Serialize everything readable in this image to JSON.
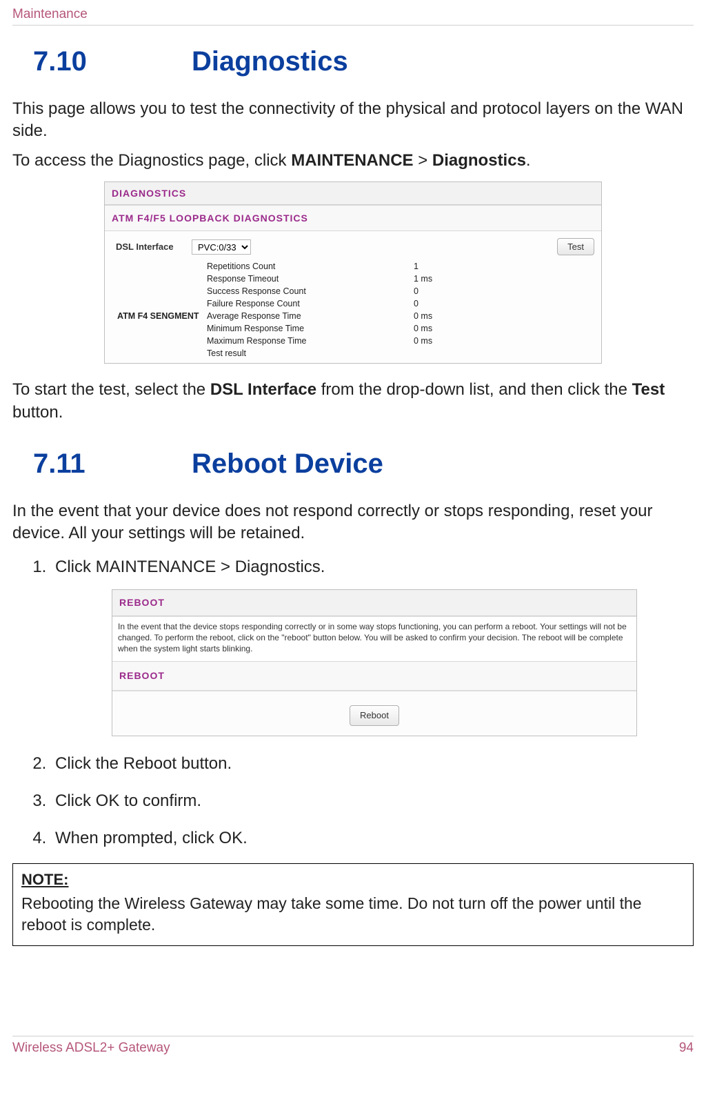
{
  "header": "Maintenance",
  "section1": {
    "num": "7.10",
    "title": "Diagnostics"
  },
  "para_intro": "This page allows you to test the connectivity of the physical and protocol layers on the WAN side.",
  "para_access_pre": "To access the Diagnostics page, click ",
  "para_access_b1": "MAINTENANCE",
  "para_access_mid": " > ",
  "para_access_b2": "Diagnostics",
  "para_access_post": ".",
  "diag": {
    "panel_title": "DIAGNOSTICS",
    "sub_title": "ATM F4/F5 LOOPBACK DIAGNOSTICS",
    "dsl_label": "DSL Interface",
    "dsl_value": "PVC:0/33",
    "test_btn": "Test",
    "group_label": "ATM F4 SENGMENT",
    "rows": [
      {
        "k": "Repetitions Count",
        "v": "1"
      },
      {
        "k": "Response Timeout",
        "v": "1 ms"
      },
      {
        "k": "Success Response Count",
        "v": "0"
      },
      {
        "k": "Failure Response Count",
        "v": "0"
      },
      {
        "k": "Average Response Time",
        "v": "0 ms"
      },
      {
        "k": "Minimum Response Time",
        "v": "0 ms"
      },
      {
        "k": "Maximum Response Time",
        "v": "0 ms"
      },
      {
        "k": "Test result",
        "v": ""
      }
    ]
  },
  "para_start_pre": "To start the test, select the ",
  "para_start_b1": "DSL Interface",
  "para_start_mid": " from the drop-down list, and then click the ",
  "para_start_b2": "Test",
  "para_start_post": " button.",
  "section2": {
    "num": "7.11",
    "title": "Reboot Device"
  },
  "para_reboot_intro": "In the event that your device does not respond correctly or stops responding, reset your device. All your settings will be retained.",
  "step1_pre": "Click ",
  "step1_b1": "MAINTENANCE",
  "step1_mid": " > ",
  "step1_b2": "Diagnostics",
  "step1_post": ".",
  "reboot": {
    "panel_title": "REBOOT",
    "desc": "In the event that the device stops responding correctly or in some way stops functioning, you can perform a reboot. Your settings will not be changed. To perform the reboot, click on the \"reboot\" button below. You will be asked to confirm your decision. The reboot will be complete when the system light starts blinking.",
    "sub_title": "REBOOT",
    "btn": "Reboot"
  },
  "step2_pre": "Click the ",
  "step2_b": "Reboot",
  "step2_post": " button.",
  "step3_pre": "Click ",
  "step3_b": "OK",
  "step3_post": " to confirm.",
  "step4_pre": "When prompted, click ",
  "step4_b": "OK",
  "step4_post": ".",
  "note": {
    "label": "NOTE:",
    "text": "Rebooting the Wireless Gateway may take some time. Do not turn off the power until the reboot is complete."
  },
  "footer": {
    "left": "Wireless ADSL2+ Gateway",
    "right": "94"
  }
}
